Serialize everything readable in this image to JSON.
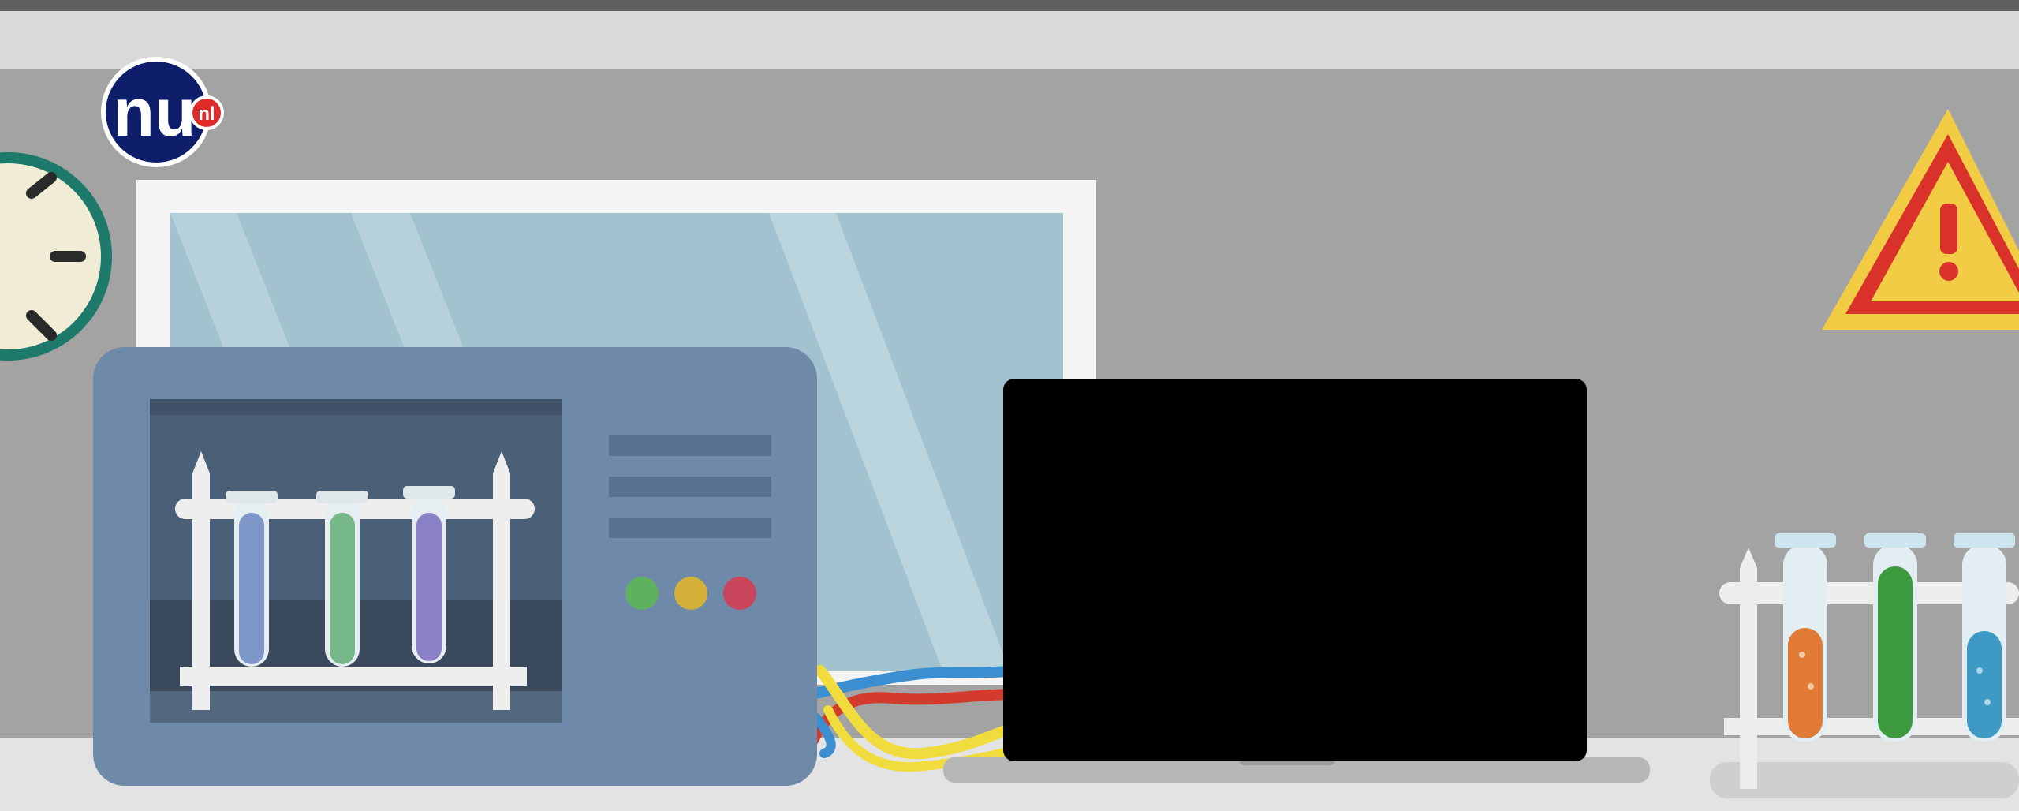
{
  "logo": {
    "text": "nu",
    "suffix": "nl"
  },
  "icons": {
    "logo": "nu-nl-logo-icon",
    "clock": "wall-clock-icon",
    "warning": "warning-triangle-icon",
    "machine": "lab-analyzer-machine-icon",
    "laptop": "laptop-icon",
    "test_tubes": "test-tube-rack-icon",
    "cables": "cables-icon"
  },
  "colors": {
    "wall": "#a3a3a3",
    "top_bar": "#5e5e5e",
    "shelf": "#dcdcdc",
    "machine_body": "#6f8aa8",
    "clock_rim": "#1d7a6a",
    "clock_face": "#f1ecd6",
    "warning_yellow": "#f2cc45",
    "warning_red": "#d8322b",
    "logo_blue": "#0f1e6b",
    "logo_red": "#e02b2b",
    "laptop_screen": "#000000",
    "indicator_green": "#5fb05f",
    "indicator_yellow": "#d4b23a",
    "indicator_red": "#c9455c"
  }
}
